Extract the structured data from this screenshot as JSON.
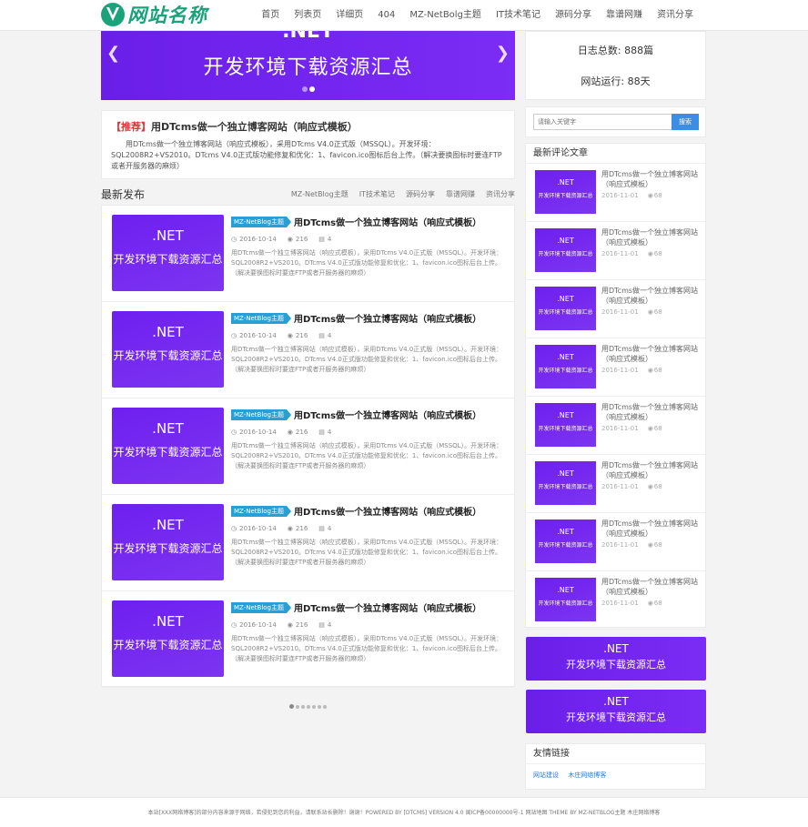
{
  "header": {
    "logo_text": "网站名称",
    "nav": [
      "首页",
      "列表页",
      "详细页",
      "404",
      "MZ-NetBolg主题",
      "IT技术笔记",
      "源码分享",
      "靠谱网赚",
      "资讯分享"
    ]
  },
  "banner": {
    "partial_text": ".NET",
    "title": "开发环境下载资源汇总",
    "prev_glyph": "❮",
    "next_glyph": "❯"
  },
  "recommend": {
    "label": "【推荐】",
    "title": "用DTcms做一个独立博客网站（响应式模板）",
    "desc": "用DTcms做一个独立博客网站（响应式模板），采用DTcms V4.0正式版（MSSQL）。开发环境：SQL2008R2+VS2010。DTcms V4.0正式版功能修复和优化：1、favicon.ico图标后台上传。（解决要换图标时要连FTP或者开服务器的麻烦）"
  },
  "latest": {
    "title": "最新发布",
    "tabs": [
      "MZ-NetBlog主题",
      "IT技术笔记",
      "源码分享",
      "靠谱网赚",
      "资讯分享"
    ]
  },
  "articles": [
    {
      "thumb_1": ".NET",
      "thumb_2": "开发环境下载资源汇总",
      "tag": "MZ-NetBlog主题",
      "title": "用DTcms做一个独立博客网站（响应式模板）",
      "date": "2016-10-14",
      "views": "216",
      "comments": "4",
      "desc": "用DTcms做一个独立博客网站（响应式模板），采用DTcms V4.0正式版（MSSQL）。开发环境：SQL2008R2+VS2010。DTcms V4.0正式版功能修复和优化：1、favicon.ico图标后台上传。（解决要换图标时要连FTP或者开服务器的麻烦）"
    },
    {
      "thumb_1": ".NET",
      "thumb_2": "开发环境下载资源汇总",
      "tag": "MZ-NetBlog主题",
      "title": "用DTcms做一个独立博客网站（响应式模板）",
      "date": "2016-10-14",
      "views": "216",
      "comments": "4",
      "desc": "用DTcms做一个独立博客网站（响应式模板），采用DTcms V4.0正式版（MSSQL）。开发环境：SQL2008R2+VS2010。DTcms V4.0正式版功能修复和优化：1、favicon.ico图标后台上传。（解决要换图标时要连FTP或者开服务器的麻烦）"
    },
    {
      "thumb_1": ".NET",
      "thumb_2": "开发环境下载资源汇总",
      "tag": "MZ-NetBlog主题",
      "title": "用DTcms做一个独立博客网站（响应式模板）",
      "date": "2016-10-14",
      "views": "216",
      "comments": "4",
      "desc": "用DTcms做一个独立博客网站（响应式模板），采用DTcms V4.0正式版（MSSQL）。开发环境：SQL2008R2+VS2010。DTcms V4.0正式版功能修复和优化：1、favicon.ico图标后台上传。（解决要换图标时要连FTP或者开服务器的麻烦）"
    },
    {
      "thumb_1": ".NET",
      "thumb_2": "开发环境下载资源汇总",
      "tag": "MZ-NetBlog主题",
      "title": "用DTcms做一个独立博客网站（响应式模板）",
      "date": "2016-10-14",
      "views": "216",
      "comments": "4",
      "desc": "用DTcms做一个独立博客网站（响应式模板），采用DTcms V4.0正式版（MSSQL）。开发环境：SQL2008R2+VS2010。DTcms V4.0正式版功能修复和优化：1、favicon.ico图标后台上传。（解决要换图标时要连FTP或者开服务器的麻烦）"
    },
    {
      "thumb_1": ".NET",
      "thumb_2": "开发环境下载资源汇总",
      "tag": "MZ-NetBlog主题",
      "title": "用DTcms做一个独立博客网站（响应式模板）",
      "date": "2016-10-14",
      "views": "216",
      "comments": "4",
      "desc": "用DTcms做一个独立博客网站（响应式模板），采用DTcms V4.0正式版（MSSQL）。开发环境：SQL2008R2+VS2010。DTcms V4.0正式版功能修复和优化：1、favicon.ico图标后台上传。（解决要换图标时要连FTP或者开服务器的麻烦）"
    }
  ],
  "stats": {
    "posts": "日志总数: 888篇",
    "runtime": "网站运行: 88天"
  },
  "search": {
    "placeholder": "请输入关键字",
    "button": "搜索"
  },
  "comments": {
    "title": "最新评论文章",
    "items": [
      {
        "thumb_1": ".NET",
        "thumb_2": "开发环境下载资源汇总",
        "title": "用DTcms做一个独立博客网站（响应式模板）",
        "date": "2016-11-01",
        "views": "68"
      },
      {
        "thumb_1": ".NET",
        "thumb_2": "开发环境下载资源汇总",
        "title": "用DTcms做一个独立博客网站（响应式模板）",
        "date": "2016-11-01",
        "views": "68"
      },
      {
        "thumb_1": ".NET",
        "thumb_2": "开发环境下载资源汇总",
        "title": "用DTcms做一个独立博客网站（响应式模板）",
        "date": "2016-11-01",
        "views": "68"
      },
      {
        "thumb_1": ".NET",
        "thumb_2": "开发环境下载资源汇总",
        "title": "用DTcms做一个独立博客网站（响应式模板）",
        "date": "2016-11-01",
        "views": "68"
      },
      {
        "thumb_1": ".NET",
        "thumb_2": "开发环境下载资源汇总",
        "title": "用DTcms做一个独立博客网站（响应式模板）",
        "date": "2016-11-01",
        "views": "68"
      },
      {
        "thumb_1": ".NET",
        "thumb_2": "开发环境下载资源汇总",
        "title": "用DTcms做一个独立博客网站（响应式模板）",
        "date": "2016-11-01",
        "views": "68"
      },
      {
        "thumb_1": ".NET",
        "thumb_2": "开发环境下载资源汇总",
        "title": "用DTcms做一个独立博客网站（响应式模板）",
        "date": "2016-11-01",
        "views": "68"
      },
      {
        "thumb_1": ".NET",
        "thumb_2": "开发环境下载资源汇总",
        "title": "用DTcms做一个独立博客网站（响应式模板）",
        "date": "2016-11-01",
        "views": "68"
      }
    ]
  },
  "ads": [
    {
      "line1": ".NET",
      "line2": "开发环境下载资源汇总"
    },
    {
      "line1": ".NET",
      "line2": "开发环境下载资源汇总"
    }
  ],
  "friend_links": {
    "title": "友情链接",
    "items": [
      "网站建设",
      "木庄网络博客"
    ]
  },
  "footer": {
    "text": "本站[XXX网络博客]的部分内容来源于网络，若侵犯到您的利益，请联系站长删除！谢谢！POWERED BY [DTCMS] VERSION 4.0  闽ICP备00000000号-1   网站地图 THEME BY MZ-NETBLOG主题 木庄网络博客"
  },
  "colors": {
    "brand_green": "#1aa37a",
    "banner_purple": "#6a1fe8",
    "tag_blue": "#2a9fd6",
    "recommend_red": "#e23232"
  }
}
